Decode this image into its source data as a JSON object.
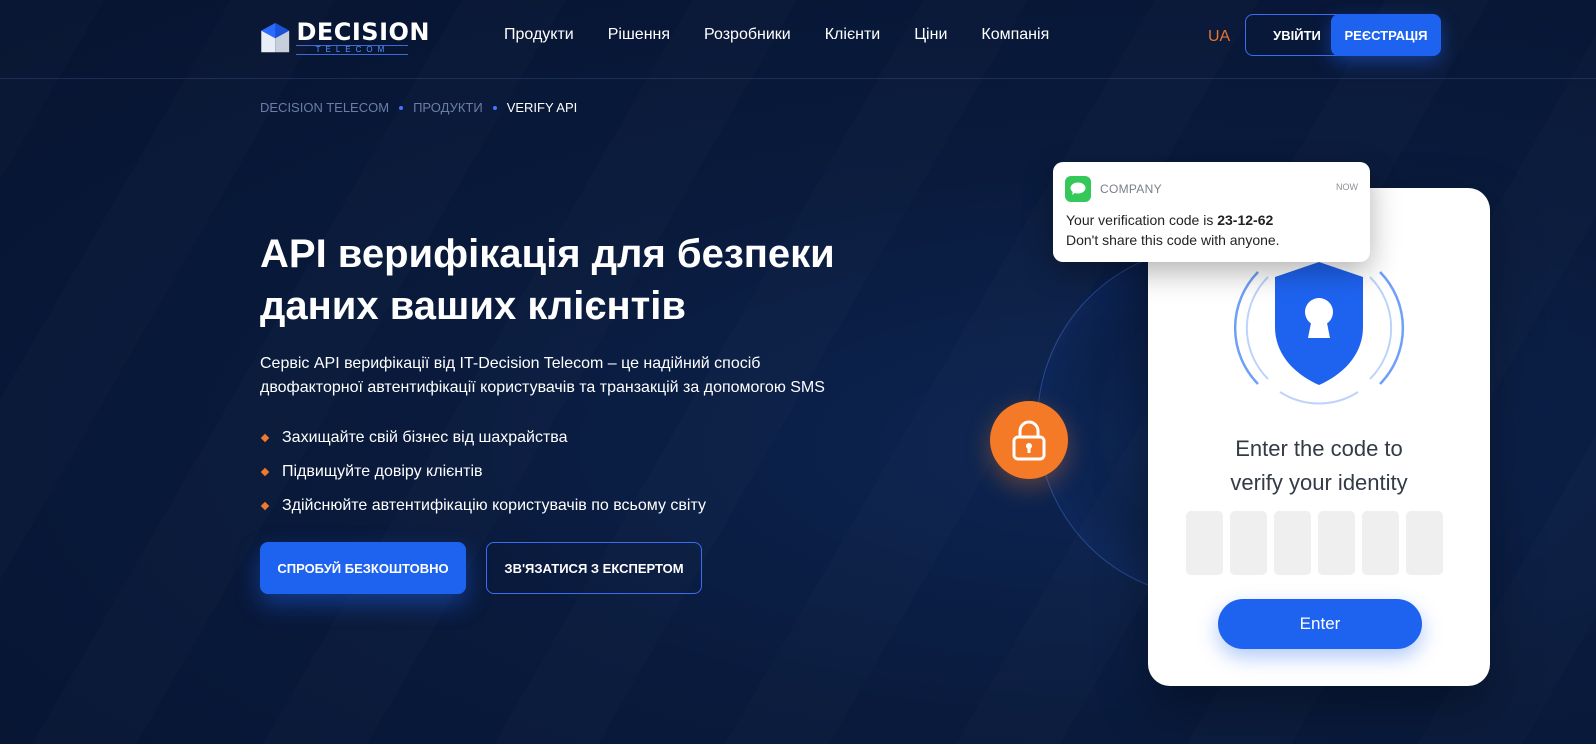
{
  "header": {
    "logo": {
      "word": "DECISION",
      "sub": "TELECOM"
    },
    "nav": [
      "Продукти",
      "Рішення",
      "Розробники",
      "Клієнти",
      "Ціни",
      "Компанія"
    ],
    "lang": "UA",
    "login_label": "УВІЙТИ",
    "register_label": "РЕЄСТРАЦІЯ"
  },
  "breadcrumb": [
    "DECISION TELECOM",
    "ПРОДУКТИ",
    "VERIFY API"
  ],
  "hero": {
    "title": "API верифікація для безпеки даних ваших клієнтів",
    "description": "Сервіс API верифікації від IT-Decision Telecom – це надійний спосіб двофакторної автентифікації користувачів та транзакцій за допомогою SMS",
    "bullets": [
      "Захищайте свій бізнес від шахрайства",
      "Підвищуйте довіру клієнтів",
      "Здійснюйте автентифікацію користувачів по всьому світу"
    ],
    "try_label": "СПРОБУЙ БЕЗКОШТОВНО",
    "expert_label": "ЗВ'ЯЗАТИСЯ З ЕКСПЕРТОМ"
  },
  "illustration": {
    "notification": {
      "app": "COMPANY",
      "time": "NOW",
      "line1_prefix": "Your verification code is ",
      "code": "23-12-62",
      "line2": "Don't share this code with anyone."
    },
    "phone": {
      "title_line1": "Enter the code to",
      "title_line2": "verify your identity",
      "enter_label": "Enter"
    }
  },
  "colors": {
    "accent_blue": "#1e63f0",
    "accent_orange": "#f47a28",
    "background": "#091a3c"
  },
  "icons": [
    "logo-mark-icon",
    "shield-icon",
    "lock-icon",
    "message-icon"
  ]
}
